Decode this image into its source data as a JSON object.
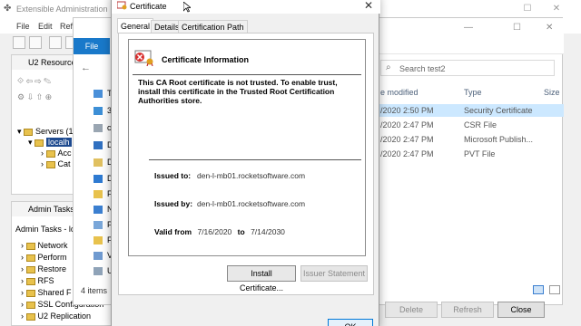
{
  "app": {
    "title": "Extensible Administration",
    "menu": [
      "File",
      "Edit",
      "Refr"
    ],
    "panel_title": "U2 Resource",
    "tree": [
      "Servers (1",
      "localh",
      "Acc",
      "Cat"
    ],
    "admin_title": "Admin Tasks",
    "admin_sub": "Admin Tasks - lo",
    "admin_items": [
      "Network",
      "Perform",
      "Restore",
      "RFS",
      "Shared F",
      "SSL Configuration",
      "U2 Replication"
    ]
  },
  "explorer": {
    "file_tab": "File",
    "search_placeholder": "Search test2",
    "columns": [
      "e modified",
      "Type",
      "Size"
    ],
    "nav_items": [
      "Th",
      "3",
      "c",
      "D",
      "D",
      "D",
      "F",
      "N",
      "P",
      "F",
      "V",
      "U"
    ],
    "rows": [
      {
        "date": "/2020 2:50 PM",
        "type": "Security Certificate"
      },
      {
        "date": "/2020 2:47 PM",
        "type": "CSR File"
      },
      {
        "date": "/2020 2:47 PM",
        "type": "Microsoft Publish..."
      },
      {
        "date": "/2020 2:47 PM",
        "type": "PVT File"
      }
    ],
    "status": "4 items",
    "buttons": {
      "delete": "Delete",
      "refresh": "Refresh",
      "close": "Close"
    }
  },
  "cert": {
    "title": "Certificate",
    "tabs": [
      "General",
      "Details",
      "Certification Path"
    ],
    "heading": "Certificate Information",
    "warning": "This CA Root certificate is not trusted. To enable trust, install this certificate in the Trusted Root Certification Authorities store.",
    "issued_to_label": "Issued to:",
    "issued_to": "den-l-mb01.rocketsoftware.com",
    "issued_by_label": "Issued by:",
    "issued_by": "den-l-mb01.rocketsoftware.com",
    "valid_from_label": "Valid from",
    "valid_from": "7/16/2020",
    "to_label": "to",
    "valid_to": "7/14/2030",
    "install_btn": "Install Certificate...",
    "issuer_btn": "Issuer Statement",
    "ok_btn": "OK"
  },
  "colors": {
    "accent": "#1979ca",
    "selected_row": "#cce8ff"
  }
}
